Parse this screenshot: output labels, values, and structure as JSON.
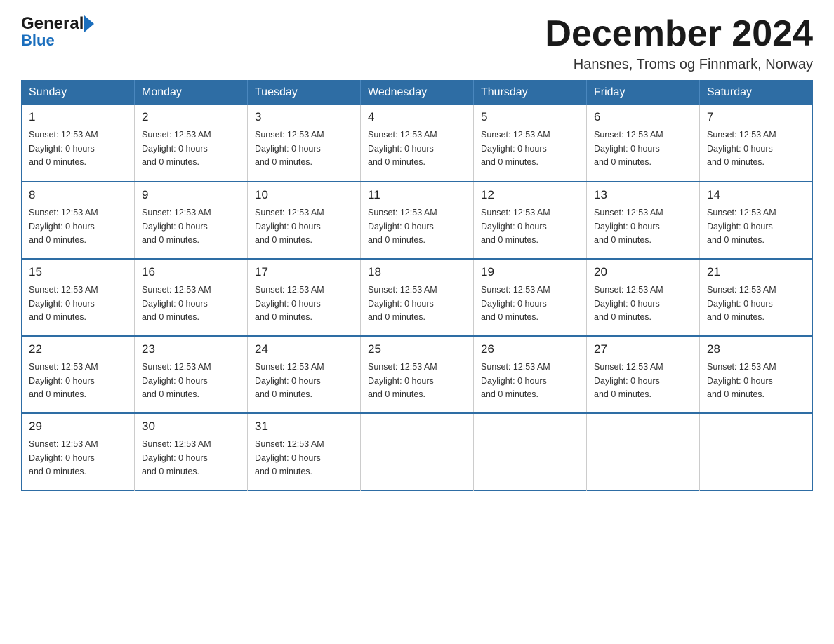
{
  "header": {
    "logo": {
      "general_text": "General",
      "blue_text": "Blue"
    },
    "title": "December 2024",
    "location": "Hansnes, Troms og Finnmark, Norway"
  },
  "calendar": {
    "days_of_week": [
      "Sunday",
      "Monday",
      "Tuesday",
      "Wednesday",
      "Thursday",
      "Friday",
      "Saturday"
    ],
    "weeks": [
      {
        "days": [
          {
            "number": "1",
            "info": "Sunset: 12:53 AM\nDaylight: 0 hours\nand 0 minutes."
          },
          {
            "number": "2",
            "info": "Sunset: 12:53 AM\nDaylight: 0 hours\nand 0 minutes."
          },
          {
            "number": "3",
            "info": "Sunset: 12:53 AM\nDaylight: 0 hours\nand 0 minutes."
          },
          {
            "number": "4",
            "info": "Sunset: 12:53 AM\nDaylight: 0 hours\nand 0 minutes."
          },
          {
            "number": "5",
            "info": "Sunset: 12:53 AM\nDaylight: 0 hours\nand 0 minutes."
          },
          {
            "number": "6",
            "info": "Sunset: 12:53 AM\nDaylight: 0 hours\nand 0 minutes."
          },
          {
            "number": "7",
            "info": "Sunset: 12:53 AM\nDaylight: 0 hours\nand 0 minutes."
          }
        ]
      },
      {
        "days": [
          {
            "number": "8",
            "info": "Sunset: 12:53 AM\nDaylight: 0 hours\nand 0 minutes."
          },
          {
            "number": "9",
            "info": "Sunset: 12:53 AM\nDaylight: 0 hours\nand 0 minutes."
          },
          {
            "number": "10",
            "info": "Sunset: 12:53 AM\nDaylight: 0 hours\nand 0 minutes."
          },
          {
            "number": "11",
            "info": "Sunset: 12:53 AM\nDaylight: 0 hours\nand 0 minutes."
          },
          {
            "number": "12",
            "info": "Sunset: 12:53 AM\nDaylight: 0 hours\nand 0 minutes."
          },
          {
            "number": "13",
            "info": "Sunset: 12:53 AM\nDaylight: 0 hours\nand 0 minutes."
          },
          {
            "number": "14",
            "info": "Sunset: 12:53 AM\nDaylight: 0 hours\nand 0 minutes."
          }
        ]
      },
      {
        "days": [
          {
            "number": "15",
            "info": "Sunset: 12:53 AM\nDaylight: 0 hours\nand 0 minutes."
          },
          {
            "number": "16",
            "info": "Sunset: 12:53 AM\nDaylight: 0 hours\nand 0 minutes."
          },
          {
            "number": "17",
            "info": "Sunset: 12:53 AM\nDaylight: 0 hours\nand 0 minutes."
          },
          {
            "number": "18",
            "info": "Sunset: 12:53 AM\nDaylight: 0 hours\nand 0 minutes."
          },
          {
            "number": "19",
            "info": "Sunset: 12:53 AM\nDaylight: 0 hours\nand 0 minutes."
          },
          {
            "number": "20",
            "info": "Sunset: 12:53 AM\nDaylight: 0 hours\nand 0 minutes."
          },
          {
            "number": "21",
            "info": "Sunset: 12:53 AM\nDaylight: 0 hours\nand 0 minutes."
          }
        ]
      },
      {
        "days": [
          {
            "number": "22",
            "info": "Sunset: 12:53 AM\nDaylight: 0 hours\nand 0 minutes."
          },
          {
            "number": "23",
            "info": "Sunset: 12:53 AM\nDaylight: 0 hours\nand 0 minutes."
          },
          {
            "number": "24",
            "info": "Sunset: 12:53 AM\nDaylight: 0 hours\nand 0 minutes."
          },
          {
            "number": "25",
            "info": "Sunset: 12:53 AM\nDaylight: 0 hours\nand 0 minutes."
          },
          {
            "number": "26",
            "info": "Sunset: 12:53 AM\nDaylight: 0 hours\nand 0 minutes."
          },
          {
            "number": "27",
            "info": "Sunset: 12:53 AM\nDaylight: 0 hours\nand 0 minutes."
          },
          {
            "number": "28",
            "info": "Sunset: 12:53 AM\nDaylight: 0 hours\nand 0 minutes."
          }
        ]
      },
      {
        "days": [
          {
            "number": "29",
            "info": "Sunset: 12:53 AM\nDaylight: 0 hours\nand 0 minutes."
          },
          {
            "number": "30",
            "info": "Sunset: 12:53 AM\nDaylight: 0 hours\nand 0 minutes."
          },
          {
            "number": "31",
            "info": "Sunset: 12:53 AM\nDaylight: 0 hours\nand 0 minutes."
          },
          {
            "number": "",
            "info": ""
          },
          {
            "number": "",
            "info": ""
          },
          {
            "number": "",
            "info": ""
          },
          {
            "number": "",
            "info": ""
          }
        ]
      }
    ]
  }
}
